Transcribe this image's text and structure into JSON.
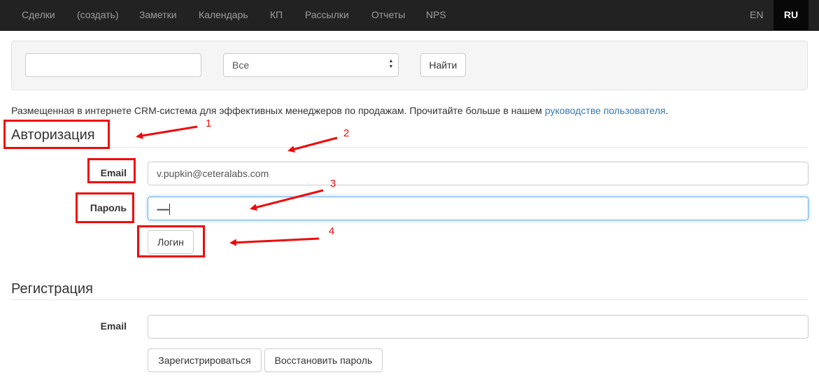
{
  "nav": {
    "items": [
      "Сделки",
      "(создать)",
      "Заметки",
      "Календарь",
      "КП",
      "Рассылки",
      "Отчеты",
      "NPS"
    ],
    "lang_en": "EN",
    "lang_ru": "RU"
  },
  "search": {
    "query": "",
    "select_value": "Все",
    "button": "Найти"
  },
  "intro": {
    "text": "Размещенная в интернете CRM-система для эффективных менеджеров по продажам. Прочитайте больше в нашем ",
    "link": "руководстве пользователя",
    "suffix": "."
  },
  "login": {
    "title": "Авторизация",
    "email_label": "Email",
    "email_value": "v.pupkin@ceteralabs.com",
    "password_label": "Пароль",
    "password_value": "••••••••",
    "submit": "Логин"
  },
  "register": {
    "title": "Регистрация",
    "email_label": "Email",
    "email_value": "",
    "register_button": "Зарегистрироваться",
    "restore_button": "Восстановить пароль"
  },
  "annotations": {
    "labels": [
      "1",
      "2",
      "3",
      "4"
    ],
    "color": "#ee0a0a"
  },
  "colors": {
    "navbar": "#222222",
    "link": "#337ab7",
    "focus": "#66afe9"
  }
}
